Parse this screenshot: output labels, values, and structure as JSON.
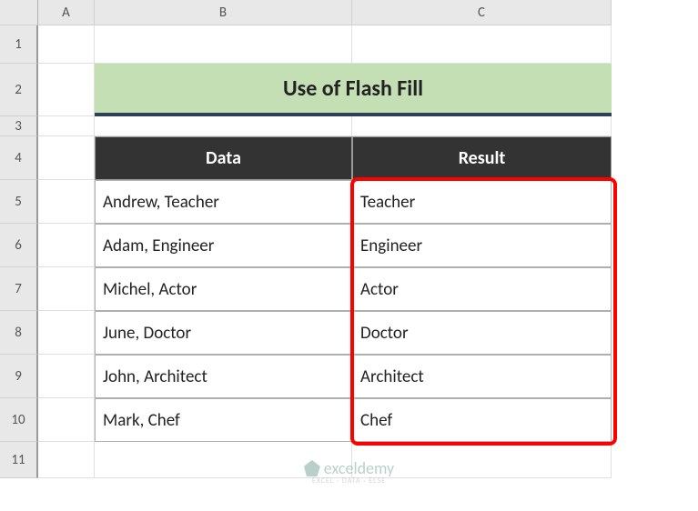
{
  "columns": [
    "A",
    "B",
    "C"
  ],
  "rows": [
    "1",
    "2",
    "3",
    "4",
    "5",
    "6",
    "7",
    "8",
    "9",
    "10",
    "11"
  ],
  "title": "Use of Flash Fill",
  "tableHeaders": {
    "data": "Data",
    "result": "Result"
  },
  "tableData": [
    {
      "data": "Andrew, Teacher",
      "result": "Teacher"
    },
    {
      "data": "Adam, Engineer",
      "result": "Engineer"
    },
    {
      "data": "Michel, Actor",
      "result": "Actor"
    },
    {
      "data": "June, Doctor",
      "result": "Doctor"
    },
    {
      "data": "John, Architect",
      "result": "Architect"
    },
    {
      "data": "Mark, Chef",
      "result": "Chef"
    }
  ],
  "watermark": {
    "name": "exceldemy",
    "tagline": "EXCEL · DATA · ELSE"
  }
}
